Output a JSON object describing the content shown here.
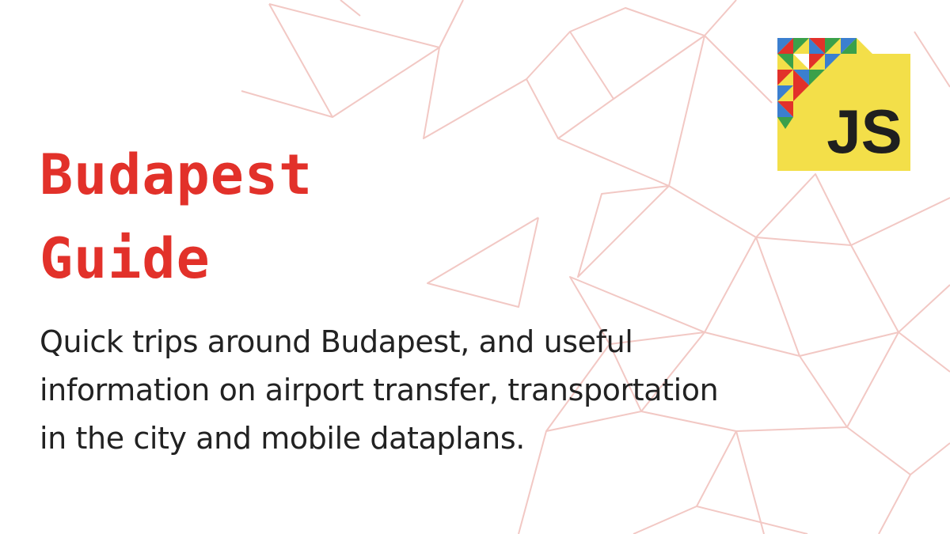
{
  "colors": {
    "accent": "#e2312a",
    "text": "#222222",
    "pattern": "#f2c8c4",
    "logo_background": "#f3df49",
    "logo_text": "#1f1f1f",
    "logo_red": "#e2312a",
    "logo_blue": "#3b7fcf",
    "logo_green": "#3aa04a"
  },
  "title_lines": [
    "Budapest",
    "Guide"
  ],
  "description_lines": [
    "Quick trips around Budapest, and useful",
    "information on airport transfer, transportation",
    "in the city and mobile dataplans."
  ],
  "logo": {
    "text": "JS",
    "icon": "js-conference-logo"
  }
}
